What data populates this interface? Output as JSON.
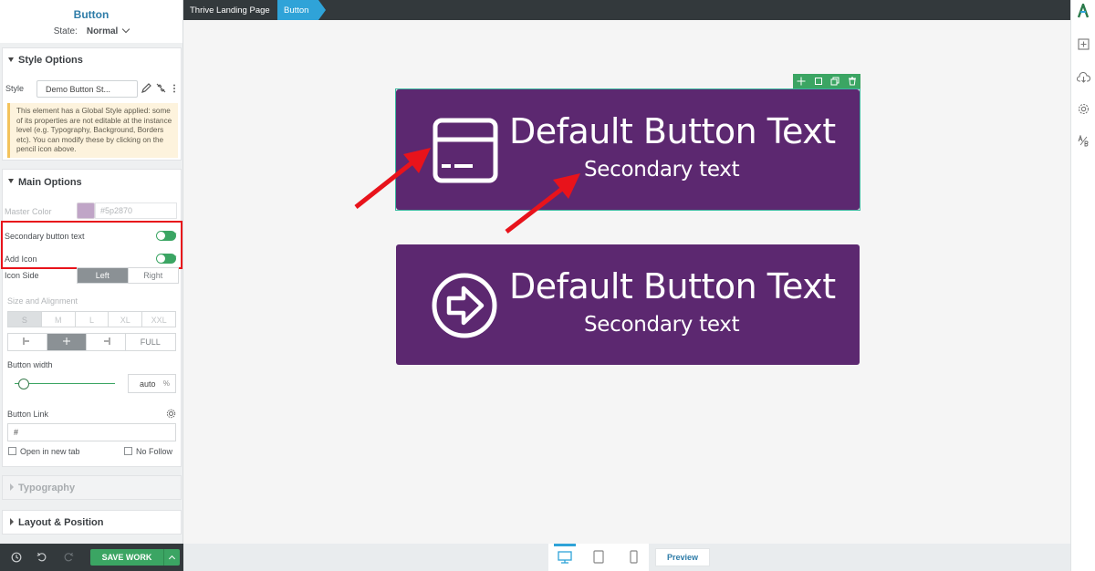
{
  "sidebar": {
    "title": "Button",
    "state_label": "State:",
    "state_value": "Normal",
    "style_options": {
      "heading": "Style Options",
      "style_label": "Style",
      "style_value": "Demo Button St...",
      "notice": "This element has a Global Style applied: some of its properties are not editable at the instance level (e.g. Typography, Background, Borders etc). You can modify these by clicking on the pencil icon above."
    },
    "main_options": {
      "heading": "Main Options",
      "master_color_label": "Master Color",
      "master_color_hex": "#5p2870",
      "master_color_swatch": "#c0a5c7",
      "secondary_text_label": "Secondary button text",
      "add_icon_label": "Add Icon",
      "icon_side_label": "Icon Side",
      "icon_side_options": [
        "Left",
        "Right"
      ],
      "icon_side_selected": "Left",
      "size_label": "Size and Alignment",
      "sizes": [
        "S",
        "M",
        "L",
        "XL",
        "XXL"
      ],
      "size_selected": "S",
      "align_full": "FULL",
      "align_selected": "center",
      "width_label": "Button width",
      "width_value": "auto",
      "width_unit": "%",
      "link_label": "Button Link",
      "link_value": "#",
      "open_new_tab": "Open in new tab",
      "no_follow": "No Follow"
    },
    "typography_heading": "Typography",
    "layout_heading": "Layout & Position",
    "save_label": "SAVE WORK"
  },
  "breadcrumb": [
    "Thrive Landing Page",
    "Button"
  ],
  "canvas": {
    "button1": {
      "main": "Default Button Text",
      "secondary": "Secondary text",
      "icon": "credit-card-icon"
    },
    "button2": {
      "main": "Default Button Text",
      "secondary": "Secondary text",
      "icon": "arrow-circle-right-icon"
    },
    "button_color": "#5c2870"
  },
  "devicebar": {
    "preview": "Preview"
  },
  "colors": {
    "accent_green": "#3ba563",
    "accent_blue": "#2fa3d8",
    "highlight_red": "#e8131b"
  }
}
